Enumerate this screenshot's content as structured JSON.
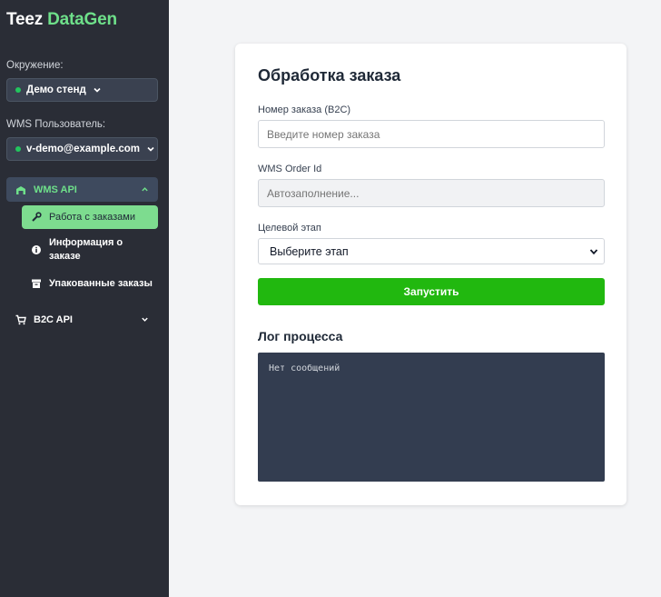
{
  "brand": {
    "part1": "Teez",
    "part2": "DataGen"
  },
  "environment": {
    "label": "Окружение:",
    "value": "Демо стенд"
  },
  "wms_user": {
    "label": "WMS Пользователь:",
    "value": "v-demo@example.com"
  },
  "nav": {
    "wms_api": {
      "label": "WMS API",
      "items": [
        {
          "label": "Работа с заказами",
          "icon": "wrench-icon"
        },
        {
          "label_line1": "Информация о",
          "label_line2": "заказе",
          "icon": "info-icon"
        },
        {
          "label": "Упакованные заказы",
          "icon": "archive-icon"
        }
      ]
    },
    "b2c_api": {
      "label": "B2C API"
    }
  },
  "form": {
    "title": "Обработка заказа",
    "order_number": {
      "label": "Номер заказа (B2C)",
      "placeholder": "Введите номер заказа"
    },
    "wms_order_id": {
      "label": "WMS Order Id",
      "placeholder": "Автозаполнение..."
    },
    "target_stage": {
      "label": "Целевой этап",
      "value": "Выберите этап"
    },
    "run_label": "Запустить"
  },
  "log": {
    "title": "Лог процесса",
    "empty": "Нет сообщений"
  },
  "colors": {
    "accent": "#6ee08a",
    "run_button": "#21b80f",
    "sidebar": "#2a2d36"
  }
}
